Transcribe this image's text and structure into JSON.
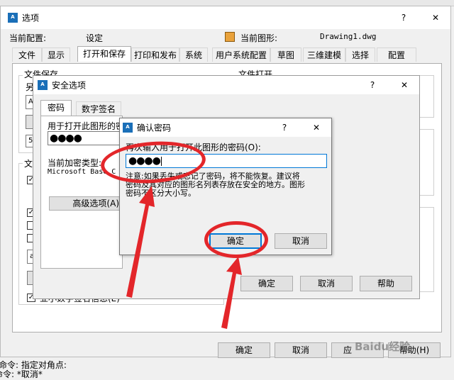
{
  "main_window": {
    "app_icon": "autocad-app-icon",
    "title": "选项",
    "help_glyph": "?",
    "close_glyph": "✕",
    "profile_label": "当前配置:",
    "profile_value": "设定",
    "drawing_label": "当前图形:",
    "drawing_value": "Drawing1.dwg",
    "drawing_icon": "drawing-file-icon",
    "tabs": [
      "文件",
      "显示",
      "打开和保存",
      "打印和发布",
      "系统",
      "用户系统配置",
      "草图",
      "三维建模",
      "选择",
      "配置"
    ],
    "active_tab": 2,
    "file_save_label": "文件保存",
    "saveas_partial": "另",
    "file_open_label": "文件打开",
    "partial_field_a": "A",
    "partial_field_50": "50",
    "file_section_partial": "文件",
    "partial_field_a2": "a",
    "digital_sig_partial": "业小数字签名信息(E)",
    "ok": "确定",
    "cancel": "取消",
    "apply_partial": "应",
    "help": "帮助(H)"
  },
  "security_dialog": {
    "app_icon": "autocad-app-icon",
    "title": "安全选项",
    "help_glyph": "?",
    "close_glyph": "✕",
    "tabs": [
      "密码",
      "数字签名"
    ],
    "active_tab": 0,
    "password_label": "用于打开此图形的密",
    "password_value": "●●●●",
    "encryption_label": "当前加密类型:",
    "encryption_value": "Microsoft Base C",
    "advanced_button": "高级选项(A)",
    "ok": "确定",
    "cancel": "取消",
    "help": "帮助"
  },
  "confirm_dialog": {
    "app_icon": "autocad-app-icon",
    "title": "确认密码",
    "help_glyph": "?",
    "close_glyph": "✕",
    "prompt": "再次输入用于打开此图形的密码(O):",
    "password_value": "●●●●",
    "warning_line1": "注意:如果丢失或忘记了密码，将不能恢复。建议将",
    "warning_line2": "密码及其对应的图形名列表存放在安全的地方。图形",
    "warning_line3": "密码不区分大小写。",
    "ok": "确定",
    "cancel": "取消"
  },
  "command_line": {
    "line1": "命令: 指定对角点:",
    "line2": "命令: *取消*"
  },
  "watermark": "Baidu经验",
  "annotation_color": "#e3262a"
}
